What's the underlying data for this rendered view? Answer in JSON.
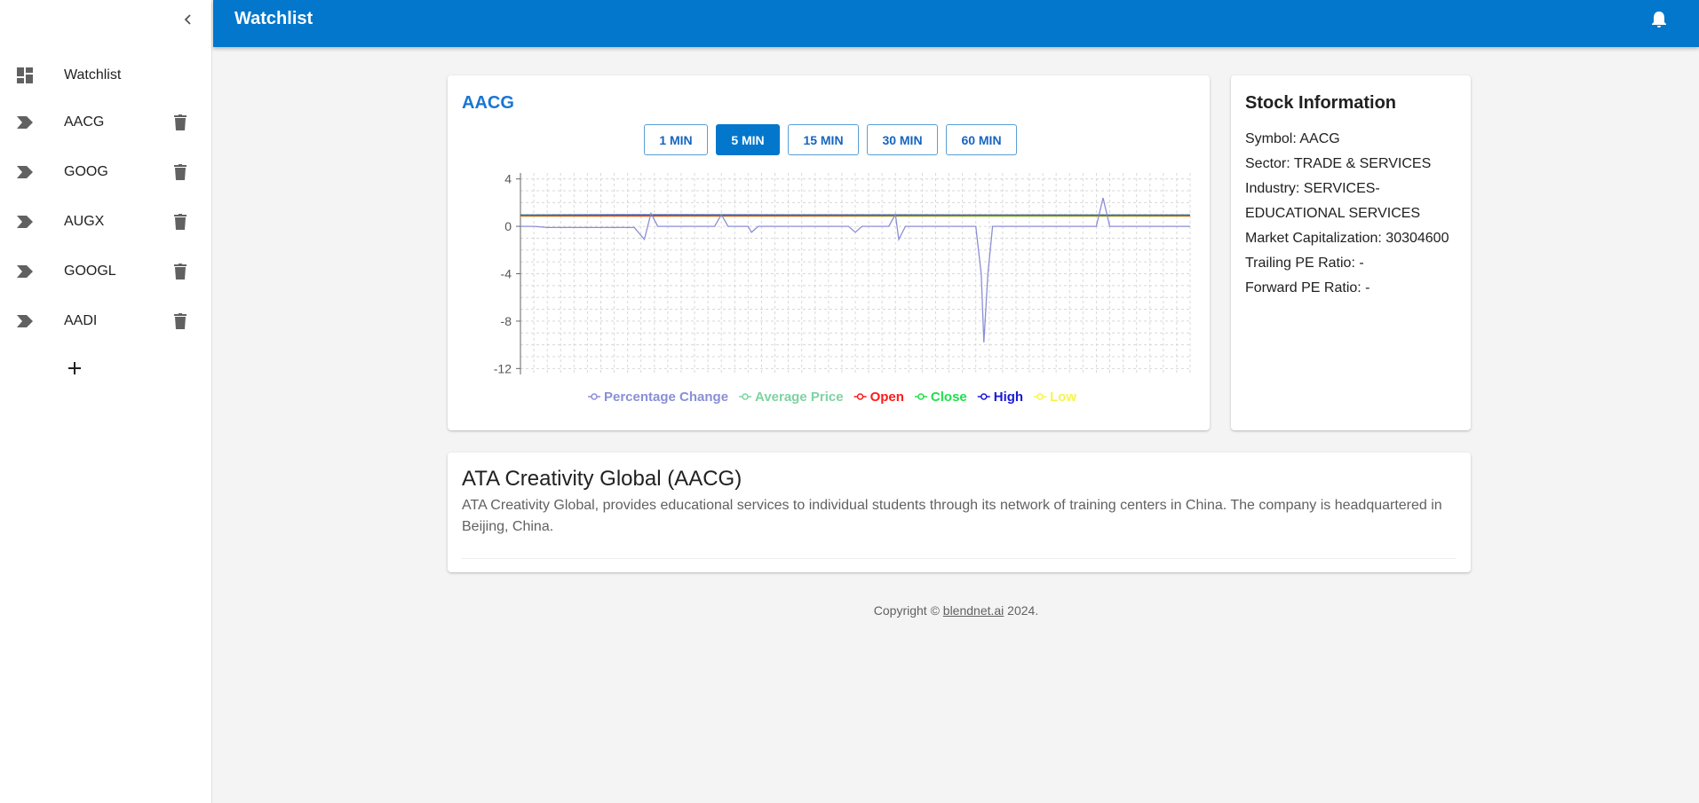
{
  "app": {
    "title": "Watchlist"
  },
  "sidebar": {
    "items": [
      {
        "label": "Watchlist",
        "icon": "dashboard-icon"
      },
      {
        "label": "AACG",
        "icon": "label-arrow-icon"
      },
      {
        "label": "GOOG",
        "icon": "label-arrow-icon"
      },
      {
        "label": "AUGX",
        "icon": "label-arrow-icon"
      },
      {
        "label": "GOOGL",
        "icon": "label-arrow-icon"
      },
      {
        "label": "AADI",
        "icon": "label-arrow-icon"
      }
    ],
    "add_icon": "plus-icon",
    "collapse_icon": "chevron-left-icon",
    "delete_icon": "trash-icon"
  },
  "header": {
    "bell_icon": "bell-icon"
  },
  "chart_card": {
    "title": "AACG",
    "intervals": [
      "1 MIN",
      "5 MIN",
      "15 MIN",
      "30 MIN",
      "60 MIN"
    ],
    "active_interval": "5 MIN"
  },
  "chart_data": {
    "type": "line",
    "title": "",
    "xlabel": "",
    "ylabel": "",
    "ylim": [
      -12.5,
      4.5
    ],
    "yticks": [
      4,
      0,
      -4,
      -8,
      -12
    ],
    "grid": true,
    "legend_placement": "bottom",
    "series": [
      {
        "name": "Percentage Change",
        "color": "#8a8fd6",
        "points": [
          [
            0,
            0
          ],
          [
            2,
            0
          ],
          [
            4,
            -0.1
          ],
          [
            8,
            -0.1
          ],
          [
            17,
            -0.1
          ],
          [
            18.5,
            -1.1
          ],
          [
            19.5,
            1.1
          ],
          [
            20.5,
            0
          ],
          [
            29,
            0
          ],
          [
            30,
            1
          ],
          [
            31,
            0
          ],
          [
            34,
            0
          ],
          [
            34.5,
            -0.5
          ],
          [
            35.5,
            0
          ],
          [
            49,
            0
          ],
          [
            50,
            -0.5
          ],
          [
            51,
            0
          ],
          [
            55,
            0
          ],
          [
            56,
            1
          ],
          [
            56.5,
            -1.1
          ],
          [
            57.5,
            0
          ],
          [
            68,
            0
          ],
          [
            68.8,
            -4
          ],
          [
            69.2,
            -9.8
          ],
          [
            69.8,
            -4
          ],
          [
            70.5,
            0
          ],
          [
            86,
            0
          ],
          [
            87,
            2.4
          ],
          [
            88,
            0
          ],
          [
            100,
            0
          ]
        ]
      },
      {
        "name": "Average Price",
        "color": "#7ed3a3",
        "points": [
          [
            0,
            0.95
          ],
          [
            100,
            0.95
          ]
        ]
      },
      {
        "name": "Open",
        "color": "#ff1a1a",
        "points": [
          [
            0,
            0.9
          ],
          [
            20,
            0.88
          ],
          [
            50,
            0.9
          ],
          [
            69,
            0.92
          ],
          [
            100,
            0.9
          ]
        ]
      },
      {
        "name": "Close",
        "color": "#1fe04a",
        "points": [
          [
            0,
            0.88
          ],
          [
            100,
            0.88
          ]
        ]
      },
      {
        "name": "High",
        "color": "#1a1ad6",
        "points": [
          [
            0,
            0.95
          ],
          [
            15,
            0.97
          ],
          [
            69,
            0.95
          ],
          [
            100,
            0.95
          ]
        ]
      },
      {
        "name": "Low",
        "color": "#f5f54a",
        "points": [
          [
            0,
            0.85
          ],
          [
            100,
            0.85
          ]
        ]
      }
    ],
    "overlay_color": "#6b8a2e"
  },
  "stock_info": {
    "title": "Stock Information",
    "symbol": "Symbol: AACG",
    "sector": "Sector: TRADE & SERVICES",
    "industry_1": "Industry: SERVICES-",
    "industry_2": "EDUCATIONAL SERVICES",
    "market_cap": "Market Capitalization: 30304600",
    "trailing_pe": "Trailing PE Ratio: -",
    "forward_pe": "Forward PE Ratio: -"
  },
  "description": {
    "title": "ATA Creativity Global (AACG)",
    "text": "ATA Creativity Global, provides educational services to individual students through its network of training centers in China. The company is headquartered in Beijing, China."
  },
  "footer": {
    "prefix": "Copyright © ",
    "link": "blendnet.ai",
    "suffix": " 2024."
  },
  "colors": {
    "brand": "#0277cc",
    "accent": "#1976d2"
  }
}
